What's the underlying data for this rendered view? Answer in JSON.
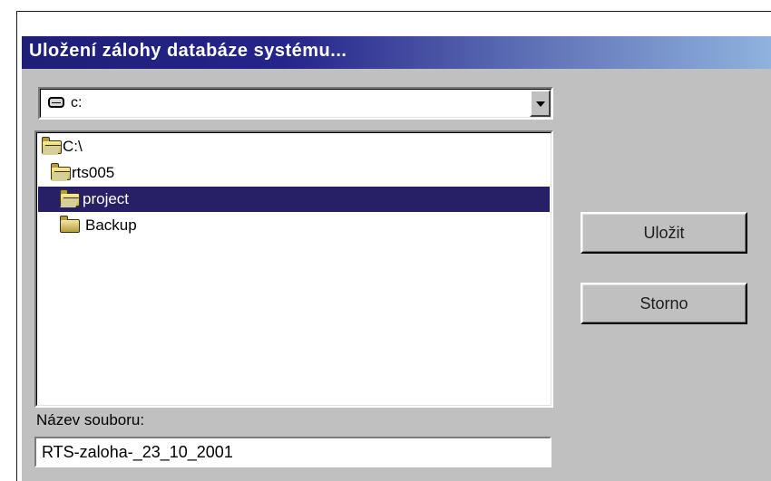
{
  "window": {
    "title": "Uložení zálohy databáze systému..."
  },
  "drive_selector": {
    "selected_drive": "c:"
  },
  "folders": [
    {
      "label": "C:\\",
      "icon": "open-folder-icon",
      "selected": false
    },
    {
      "label": "rts005",
      "icon": "open-folder-icon",
      "selected": false
    },
    {
      "label": "project",
      "icon": "open-folder-icon",
      "selected": true
    },
    {
      "label": "Backup",
      "icon": "folder-icon",
      "selected": false
    }
  ],
  "buttons": {
    "save": "Uložit",
    "cancel": "Storno"
  },
  "file_name": {
    "label": "Název souboru:",
    "value": "RTS-zaloha-_23_10_2001"
  },
  "colors": {
    "title_bar_dark": "#1f1f78",
    "title_bar_light": "#8fb2de",
    "selection": "#282066",
    "window_background": "#c0c0c0"
  }
}
